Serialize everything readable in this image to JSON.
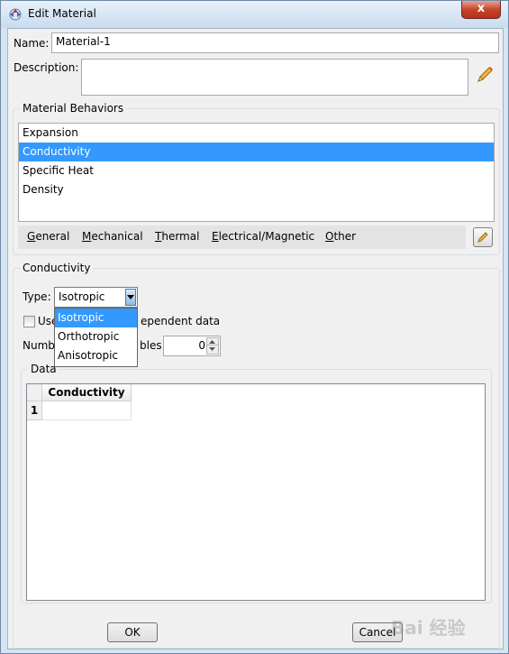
{
  "window": {
    "title": "Edit Material",
    "close_label": "x"
  },
  "name": {
    "label": "Name:",
    "value": "Material-1"
  },
  "description": {
    "label": "Description:",
    "value": ""
  },
  "behaviors": {
    "title": "Material Behaviors",
    "items": [
      "Expansion",
      "Conductivity",
      "Specific Heat",
      "Density"
    ],
    "selected": "Conductivity"
  },
  "menu": [
    {
      "first": "G",
      "rest": "eneral"
    },
    {
      "first": "M",
      "rest": "echanical"
    },
    {
      "first": "T",
      "rest": "hermal"
    },
    {
      "first": "E",
      "rest": "lectrical/Magnetic"
    },
    {
      "first": "O",
      "rest": "ther"
    }
  ],
  "conductivity": {
    "title": "Conductivity",
    "type_label": "Type:",
    "type_value": "Isotropic",
    "type_options": [
      "Isotropic",
      "Orthotropic",
      "Anisotropic"
    ],
    "use_dep_prefix": "Use",
    "use_dep_suffix": "ependent data",
    "num_prefix": "Numb",
    "num_suffix": "bles:",
    "num_value": "0"
  },
  "data_table": {
    "title": "Data",
    "column": "Conductivity",
    "row_number": "1"
  },
  "buttons": {
    "ok": "OK",
    "cancel": "Cancel"
  },
  "watermark": {
    "text": "Bai 经验",
    "color": "#7f7f7f"
  }
}
